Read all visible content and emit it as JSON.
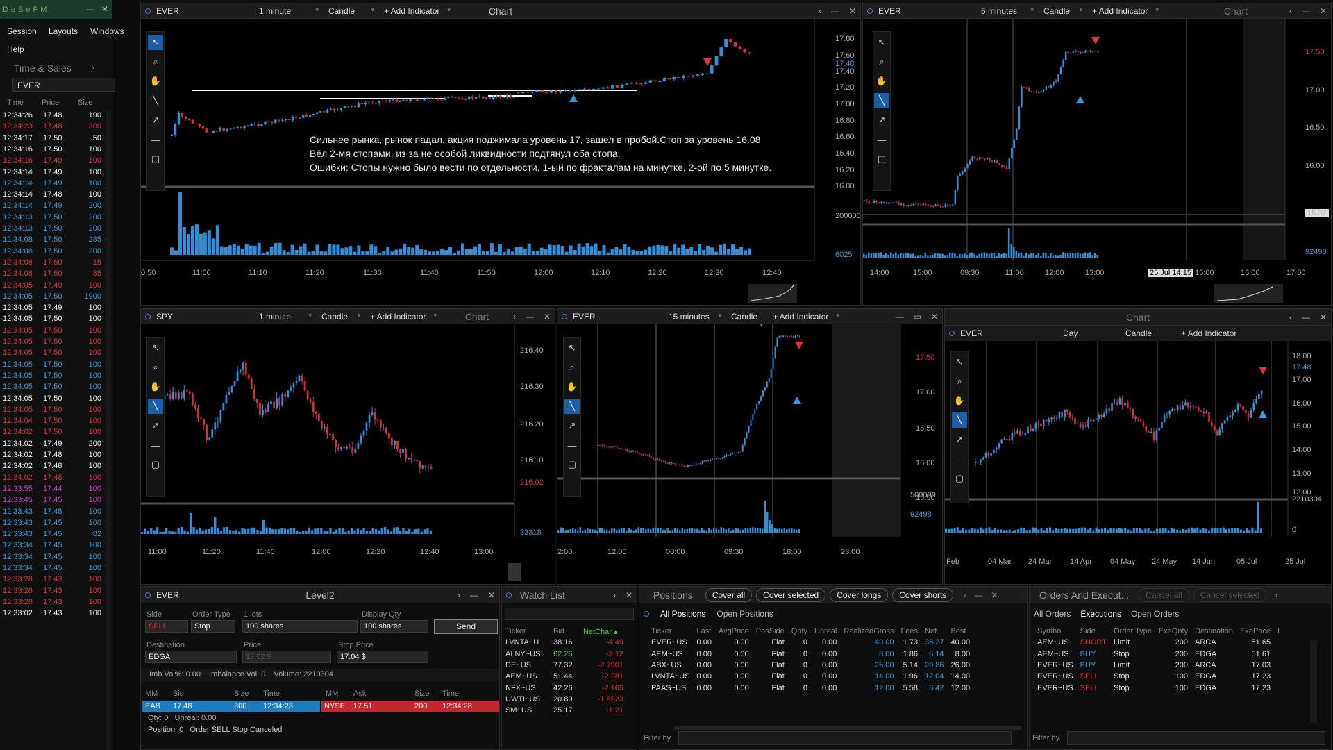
{
  "left_panel": {
    "menu": [
      "Session",
      "Layouts",
      "Windows",
      "Help"
    ],
    "panel_title": "Time & Sales",
    "symbol": "EVER",
    "columns": [
      "Time",
      "Price",
      "Size"
    ],
    "rows": [
      [
        "12:34:26",
        "17.48",
        "190",
        "w"
      ],
      [
        "12:34:23",
        "17.48",
        "300",
        "r"
      ],
      [
        "12:34:17",
        "17.50",
        "50",
        "w"
      ],
      [
        "12:34:16",
        "17.50",
        "100",
        "w"
      ],
      [
        "12:34:16",
        "17.49",
        "100",
        "r"
      ],
      [
        "12:34:14",
        "17.49",
        "100",
        "w"
      ],
      [
        "12:34:14",
        "17.49",
        "100",
        "b"
      ],
      [
        "12:34:14",
        "17.48",
        "100",
        "w"
      ],
      [
        "12:34:14",
        "17.49",
        "200",
        "b"
      ],
      [
        "12:34:13",
        "17.50",
        "200",
        "b"
      ],
      [
        "12:34:13",
        "17.50",
        "200",
        "b"
      ],
      [
        "12:34:08",
        "17.50",
        "285",
        "b"
      ],
      [
        "12:34:08",
        "17.50",
        "200",
        "b"
      ],
      [
        "12:34:08",
        "17.50",
        "15",
        "r"
      ],
      [
        "12:34:08",
        "17.50",
        "85",
        "r"
      ],
      [
        "12:34:05",
        "17.49",
        "100",
        "r"
      ],
      [
        "12:34:05",
        "17.50",
        "1900",
        "b"
      ],
      [
        "12:34:05",
        "17.49",
        "100",
        "w"
      ],
      [
        "12:34:05",
        "17.50",
        "100",
        "w"
      ],
      [
        "12:34:05",
        "17.50",
        "100",
        "r"
      ],
      [
        "12:34:05",
        "17.50",
        "100",
        "r"
      ],
      [
        "12:34:05",
        "17.50",
        "100",
        "r"
      ],
      [
        "12:34:05",
        "17.50",
        "100",
        "b"
      ],
      [
        "12:34:05",
        "17.50",
        "100",
        "b"
      ],
      [
        "12:34:05",
        "17.50",
        "100",
        "b"
      ],
      [
        "12:34:05",
        "17.50",
        "100",
        "w"
      ],
      [
        "12:34:05",
        "17.50",
        "100",
        "r"
      ],
      [
        "12:34:04",
        "17.50",
        "100",
        "r"
      ],
      [
        "12:34:02",
        "17.50",
        "100",
        "r"
      ],
      [
        "12:34:02",
        "17.49",
        "200",
        "w"
      ],
      [
        "12:34:02",
        "17.48",
        "100",
        "w"
      ],
      [
        "12:34:02",
        "17.48",
        "100",
        "w"
      ],
      [
        "12:34:02",
        "17.48",
        "100",
        "r"
      ],
      [
        "12:33:55",
        "17.44",
        "100",
        "m"
      ],
      [
        "12:33:45",
        "17.45",
        "100",
        "m"
      ],
      [
        "12:33:43",
        "17.45",
        "100",
        "b"
      ],
      [
        "12:33:43",
        "17.45",
        "100",
        "b"
      ],
      [
        "12:33:43",
        "17.45",
        "82",
        "b"
      ],
      [
        "12:33:34",
        "17.45",
        "100",
        "b"
      ],
      [
        "12:33:34",
        "17.45",
        "100",
        "b"
      ],
      [
        "12:33:34",
        "17.45",
        "100",
        "b"
      ],
      [
        "12:33:28",
        "17.43",
        "100",
        "r"
      ],
      [
        "12:33:28",
        "17.43",
        "100",
        "r"
      ],
      [
        "12:33:28",
        "17.43",
        "100",
        "r"
      ],
      [
        "12:33:02",
        "17.43",
        "100",
        "w"
      ]
    ]
  },
  "charts": {
    "c1": {
      "symbol": "EVER",
      "interval": "1 minute",
      "type": "Candle",
      "add": "+ Add Indicator",
      "title": "Chart",
      "y_ticks": [
        "17.80",
        "17.60",
        "17.48",
        "17.40",
        "17.20",
        "17.00",
        "16.80",
        "16.60",
        "16.40",
        "16.20",
        "16.00"
      ],
      "vol_ticks": [
        "200000",
        "6025"
      ],
      "x_ticks": [
        "0:50",
        "11:00",
        "11:10",
        "11:20",
        "11:30",
        "11:40",
        "11:50",
        "12:00",
        "12:10",
        "12:20",
        "12:30",
        "12:40"
      ],
      "note": [
        "Сильнее рынка, рынок падал, акция поджимала уровень 17, зашел в пробой.Стоп за уровень 16.08",
        "Вёл 2-мя стопами, из за не особой ликвидности подтянул оба стопа.",
        "Ошибки: Стопы нужно было вести по отдельности, 1-ый по фракталам на минутке, 2-ой по 5 минутке."
      ]
    },
    "c2": {
      "symbol": "EVER",
      "interval": "5 minutes",
      "type": "Candle",
      "add": "+ Add Indicator",
      "title": "Chart",
      "y_ticks": [
        "17.50",
        "17.00",
        "16.50",
        "16.00",
        "15.37"
      ],
      "vol_ticks": [
        "92498"
      ],
      "x_ticks": [
        "14:00",
        "15:00",
        "09:30",
        "11:00",
        "12:00",
        "13:00",
        "25 Jul 14:15",
        "15:00",
        "16:00",
        "17:00"
      ]
    },
    "c3": {
      "symbol": "SPY",
      "interval": "1 minute",
      "type": "Candle",
      "add": "+ Add Indicator",
      "title": "Chart",
      "y_ticks": [
        "216.40",
        "216.30",
        "216.20",
        "216.10",
        "216.02"
      ],
      "vol_ticks": [
        "33318"
      ],
      "x_ticks": [
        "11:00",
        "11:20",
        "11:40",
        "12:00",
        "12:20",
        "12:40",
        "13:00"
      ]
    },
    "c4": {
      "symbol": "EVER",
      "interval": "15 minutes",
      "type": "Candle",
      "add": "+ Add Indicator",
      "y_ticks": [
        "17.50",
        "17.00",
        "16.50",
        "16.00",
        "15.50"
      ],
      "vol_ticks": [
        "500000",
        "92498"
      ],
      "x_ticks": [
        "2:00",
        "12:00",
        "00:00",
        "09:30",
        "18:00",
        "23:00"
      ]
    },
    "c5": {
      "symbol": "EVER",
      "interval": "Day",
      "type": "Candle",
      "add": "+ Add Indicator",
      "title": "Chart",
      "y_ticks": [
        "18.00",
        "17.48",
        "17.00",
        "16.00",
        "15.00",
        "14.00",
        "13.00",
        "12.00",
        "2210304",
        "0"
      ],
      "x_ticks": [
        "Feb",
        "04 Mar",
        "24 Mar",
        "14 Apr",
        "04 May",
        "24 May",
        "14 Jun",
        "05 Jul",
        "25 Jul"
      ]
    }
  },
  "level2": {
    "symbol": "EVER",
    "title": "Level2",
    "side_label": "Side",
    "side": "SELL",
    "otype_label": "Order Type",
    "otype": "Stop",
    "lots_label": "1 lots",
    "qty": "100 shares",
    "dq_label": "Display Qty",
    "dq": "100 shares",
    "send": "Send",
    "dest_label": "Destination",
    "dest": "EDGA",
    "price_label": "Price",
    "price": "17.02 $",
    "stop_label": "Stop Price",
    "stop": "17.04 $",
    "imb": "Imb Vol%: 0.00",
    "imbv": "Imbalance Vol: 0",
    "vol": "Volume: 2210304",
    "cols": [
      "MM",
      "Bid",
      "Size",
      "Time",
      "MM",
      "Ask",
      "Size",
      "Time"
    ],
    "bid": [
      "EAB",
      "17.48",
      "300",
      "12:34:23"
    ],
    "ask": [
      "NYSE",
      "17.51",
      "200",
      "12:34:28"
    ],
    "qty_line": "Qty: 0   Unreal: 0.00",
    "pos_line": "Position: 0   Order SELL Stop Canceled"
  },
  "watch": {
    "title": "Watch List",
    "cols": [
      "Ticker",
      "Bid",
      "NetChar"
    ],
    "rows": [
      [
        "LVNTA~U",
        "38.16",
        "-4.49",
        "r"
      ],
      [
        "ALNY~US",
        "62.26",
        "-3.12",
        "g"
      ],
      [
        "DE~US",
        "77.32",
        "-2.7901",
        "w"
      ],
      [
        "AEM~US",
        "51.44",
        "-2.281",
        "w"
      ],
      [
        "NFX~US",
        "42.26",
        "-2.165",
        "w"
      ],
      [
        "UWTI~US",
        "20.89",
        "-1.8923",
        "w"
      ],
      [
        "SM~US",
        "25.17",
        "-1.21",
        "w"
      ]
    ]
  },
  "positions": {
    "title": "Positions",
    "buttons": [
      "Cover all",
      "Cover selected",
      "Cover longs",
      "Cover shorts"
    ],
    "tabs": [
      "All Positions",
      "Open Positions"
    ],
    "cols": [
      "Ticker",
      "Last",
      "AvgPrice",
      "PosSide",
      "Qnty",
      "Unreal",
      "RealizedGross",
      "Fees",
      "Net",
      "Best"
    ],
    "rows": [
      [
        "EVER~US",
        "0.00",
        "0.00",
        "Flat",
        "0",
        "0.00",
        "40.00",
        "1.73",
        "38.27",
        "40.00"
      ],
      [
        "AEM~US",
        "0.00",
        "0.00",
        "Flat",
        "0",
        "0.00",
        "8.00",
        "1.86",
        "6.14",
        "8.00"
      ],
      [
        "ABX~US",
        "0.00",
        "0.00",
        "Flat",
        "0",
        "0.00",
        "26.00",
        "5.14",
        "20.86",
        "26.00"
      ],
      [
        "LVNTA~US",
        "0.00",
        "0.00",
        "Flat",
        "0",
        "0.00",
        "14.00",
        "1.96",
        "12.04",
        "14.00"
      ],
      [
        "PAAS~US",
        "0.00",
        "0.00",
        "Flat",
        "0",
        "0.00",
        "12.00",
        "5.58",
        "6.42",
        "12.00"
      ]
    ],
    "filter": "Filter by"
  },
  "orders": {
    "title": "Orders And Execut...",
    "buttons": [
      "Cancel all",
      "Cancel selected"
    ],
    "tabs": [
      "All Orders",
      "Executions",
      "Open Orders"
    ],
    "cols": [
      "Symbol",
      "Side",
      "Order Type",
      "ExeQnty",
      "Destination",
      "ExePrice",
      "L"
    ],
    "rows": [
      [
        "AEM~US",
        "SHORT",
        "Limit",
        "200",
        "ARCA",
        "51.65",
        "r"
      ],
      [
        "AEM~US",
        "BUY",
        "Stop",
        "200",
        "EDGA",
        "51.61",
        "b"
      ],
      [
        "EVER~US",
        "BUY",
        "Limit",
        "200",
        "ARCA",
        "17.03",
        "b"
      ],
      [
        "EVER~US",
        "SELL",
        "Stop",
        "100",
        "EDGA",
        "17.23",
        "r"
      ],
      [
        "EVER~US",
        "SELL",
        "Stop",
        "100",
        "EDGA",
        "17.23",
        "r"
      ]
    ],
    "filter": "Filter by"
  }
}
